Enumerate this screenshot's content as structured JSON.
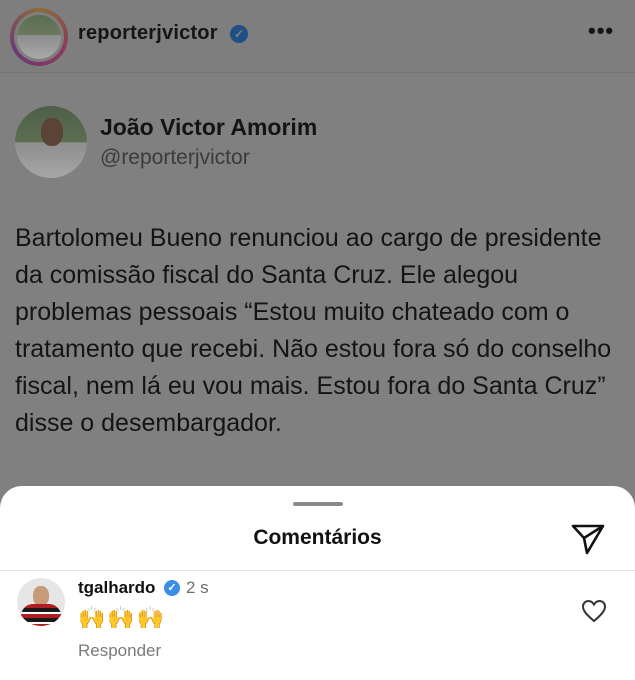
{
  "header": {
    "username": "reporterjvictor",
    "verified_mark": "✓",
    "more_label": "•••"
  },
  "tweet": {
    "name": "João Victor Amorim",
    "handle": "@reporterjvictor",
    "text": "Bartolomeu Bueno renunciou ao cargo de presidente da comissão fiscal do Santa Cruz. Ele alegou problemas pessoais “Estou muito chateado com o tratamento que recebi. Não estou fora só do conselho fiscal, nem lá eu vou mais. Estou fora do Santa Cruz” disse o desembargador."
  },
  "comments_sheet": {
    "title": "Comentários",
    "send_icon": "send-icon"
  },
  "comments": [
    {
      "username": "tgalhardo",
      "verified_mark": "✓",
      "time": "2 s",
      "text": "🙌🙌🙌",
      "reply_label": "Responder",
      "like_icon": "heart-icon"
    }
  ],
  "colors": {
    "overlay_gray": "#808080",
    "sheet_bg": "#ffffff",
    "verified_blue": "#3a8ee8"
  }
}
